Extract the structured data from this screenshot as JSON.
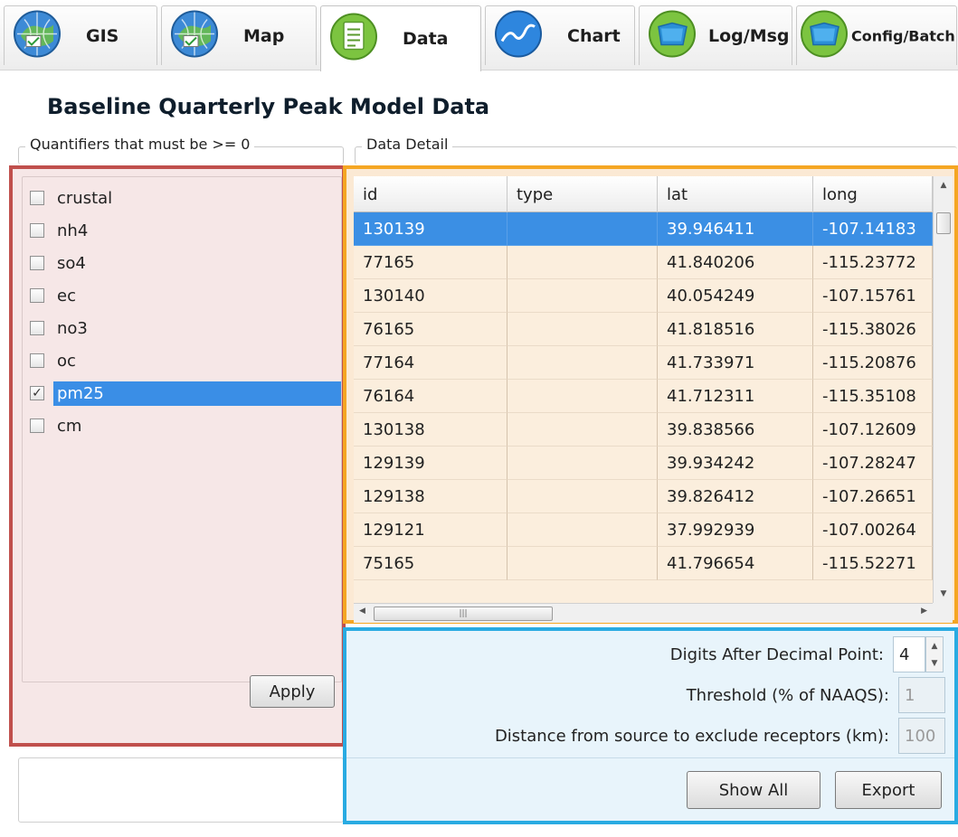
{
  "tabs": [
    {
      "label": "GIS",
      "icon": "globe-icon"
    },
    {
      "label": "Map",
      "icon": "globe-icon"
    },
    {
      "label": "Data",
      "icon": "document-icon"
    },
    {
      "label": "Chart",
      "icon": "chart-icon"
    },
    {
      "label": "Log/Msg",
      "icon": "folder-icon"
    },
    {
      "label": "Config/Batch",
      "icon": "folder-icon"
    }
  ],
  "active_tab": "Data",
  "page_title": "Baseline Quarterly Peak Model Data",
  "quantifiers": {
    "legend": "Quantifiers that must be >= 0",
    "items": [
      {
        "label": "crustal",
        "checked": false
      },
      {
        "label": "nh4",
        "checked": false
      },
      {
        "label": "so4",
        "checked": false
      },
      {
        "label": "ec",
        "checked": false
      },
      {
        "label": "no3",
        "checked": false
      },
      {
        "label": "oc",
        "checked": false
      },
      {
        "label": "pm25",
        "checked": true,
        "selected": true
      },
      {
        "label": "cm",
        "checked": false
      }
    ],
    "apply_label": "Apply"
  },
  "data_detail": {
    "legend": "Data Detail",
    "columns": [
      "id",
      "type",
      "lat",
      "long"
    ],
    "rows": [
      [
        "130139",
        "",
        "39.946411",
        "-107.14183"
      ],
      [
        "77165",
        "",
        "41.840206",
        "-115.23772"
      ],
      [
        "130140",
        "",
        "40.054249",
        "-107.15761"
      ],
      [
        "76165",
        "",
        "41.818516",
        "-115.38026"
      ],
      [
        "77164",
        "",
        "41.733971",
        "-115.20876"
      ],
      [
        "76164",
        "",
        "41.712311",
        "-115.35108"
      ],
      [
        "130138",
        "",
        "39.838566",
        "-107.12609"
      ],
      [
        "129139",
        "",
        "39.934242",
        "-107.28247"
      ],
      [
        "129138",
        "",
        "39.826412",
        "-107.26651"
      ],
      [
        "129121",
        "",
        "37.992939",
        "-107.00264"
      ],
      [
        "75165",
        "",
        "41.796654",
        "-115.52271"
      ]
    ],
    "selected_row": 0
  },
  "settings": {
    "digits_label": "Digits After Decimal Point:",
    "digits_value": "4",
    "threshold_label": "Threshold (% of NAAQS):",
    "threshold_value": "1",
    "distance_label": "Distance from source to exclude receptors (km):",
    "distance_value": "100",
    "show_all_label": "Show All",
    "export_label": "Export"
  },
  "colors": {
    "quantifier_panel_border": "#c0504d",
    "grid_panel_border": "#f5a623",
    "settings_panel_border": "#29abe2",
    "selection": "#3a8ee6"
  }
}
